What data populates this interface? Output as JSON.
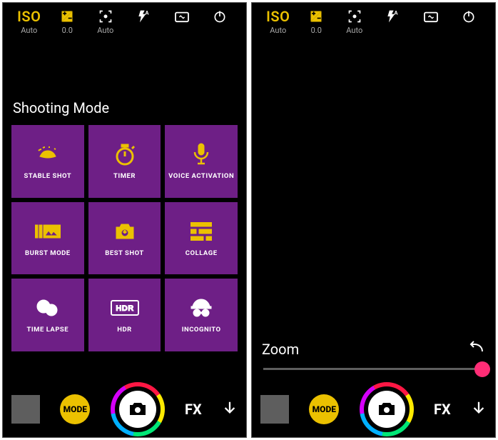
{
  "topbar": {
    "iso": {
      "label": "ISO",
      "value": "Auto"
    },
    "exposure": {
      "value": "0.0"
    },
    "focus": {
      "value": "Auto"
    }
  },
  "left_screen": {
    "section_title": "Shooting Mode",
    "modes": [
      {
        "label": "STABLE SHOT"
      },
      {
        "label": "TIMER"
      },
      {
        "label": "VOICE ACTIVATION"
      },
      {
        "label": "BURST MODE"
      },
      {
        "label": "BEST SHOT"
      },
      {
        "label": "COLLAGE"
      },
      {
        "label": "TIME LAPSE"
      },
      {
        "label": "HDR"
      },
      {
        "label": "INCOGNITO"
      }
    ]
  },
  "right_screen": {
    "zoom_label": "Zoom"
  },
  "bottombar": {
    "mode_btn": "MODE",
    "fx_btn": "FX"
  }
}
